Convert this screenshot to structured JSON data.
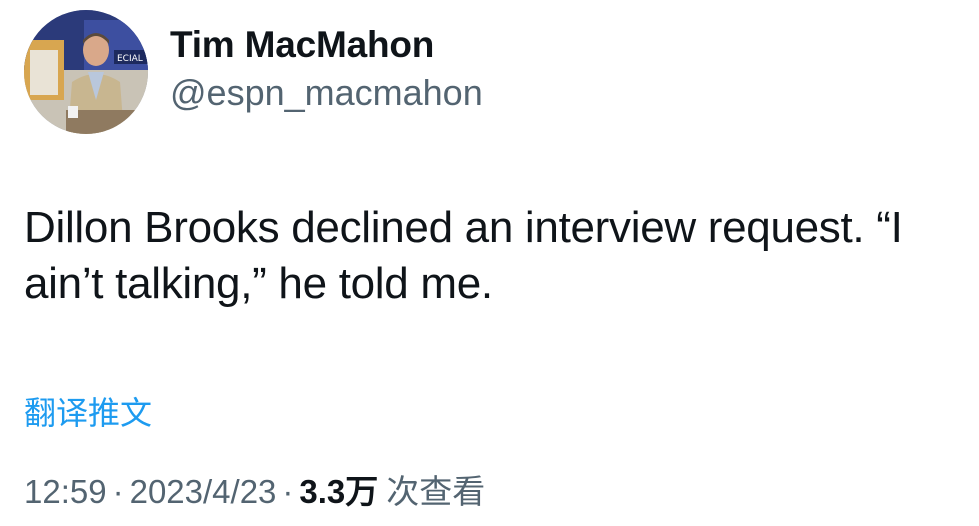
{
  "author": {
    "display_name": "Tim MacMahon",
    "handle": "@espn_macmahon",
    "avatar_icon": "avatar-photo",
    "avatar_sign_text": "ECIAL"
  },
  "tweet": {
    "text_line1": "Dillon Brooks declined an interview request. “I",
    "text_line2": "ain’t talking,” he told me."
  },
  "translate_link": "翻译推文",
  "meta": {
    "time": "12:59",
    "separator": "·",
    "date": "2023/4/23",
    "views_count": "3.3万",
    "views_label": "次查看"
  },
  "colors": {
    "text": "#0f1419",
    "secondary": "#536471",
    "link": "#1d9bf0",
    "background": "#ffffff"
  }
}
